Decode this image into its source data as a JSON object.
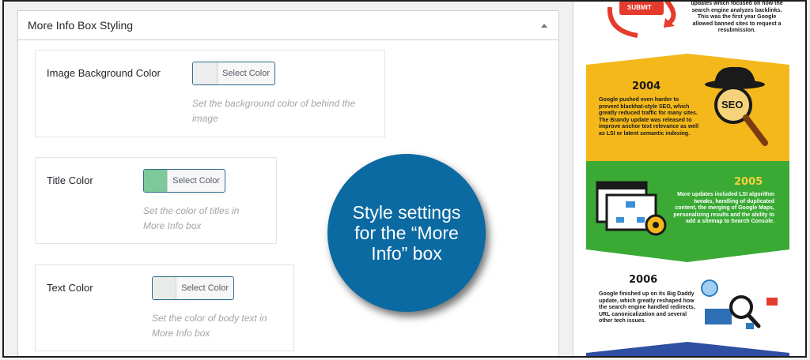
{
  "postbox": {
    "title": "More Info Box Styling",
    "settings": [
      {
        "label": "Image Background Color",
        "button": "Select Color",
        "description": "Set the background color of behind the image",
        "swatch": "#eeeeee"
      },
      {
        "label": "Title Color",
        "button": "Select Color",
        "description": "Set the color of titles in More Info box",
        "swatch": "#7ec89a"
      },
      {
        "label": "Text Color",
        "button": "Select Color",
        "description": "Set the color of body text in More Info box",
        "swatch": "#e8ece9"
      }
    ]
  },
  "callout": {
    "text": "Style settings for the “More Info” box",
    "color": "#0b6aa2"
  },
  "infographic": {
    "top_button": "SUBMIT",
    "top_text": "updates which focused on how the search engine analyzes backlinks. This was the first year Google allowed banned sites to request a resubmission.",
    "sections": [
      {
        "year": "2004",
        "text": "Google pushed even harder to prevent blackhat-style SEO, which greatly reduced traffic for many sites. The Brandy update was released to improve anchor text relevance as well as LSI or latent semantic indexing.",
        "color": "#f4b81a",
        "icon_label": "SEO"
      },
      {
        "year": "2005",
        "text": "More updates included LSI algorithm tweaks, handling of duplicated content, the merging of Google Maps, personalizing results and the ability to add a sitemap to Search Console.",
        "color": "#3aaa35"
      },
      {
        "year": "2006",
        "text": "Google finished up on its Big Daddy update, which greatly reshaped how the search engine handled redirects, URL canonicalization and several other tech issues.",
        "color": "#ffffff"
      }
    ]
  }
}
